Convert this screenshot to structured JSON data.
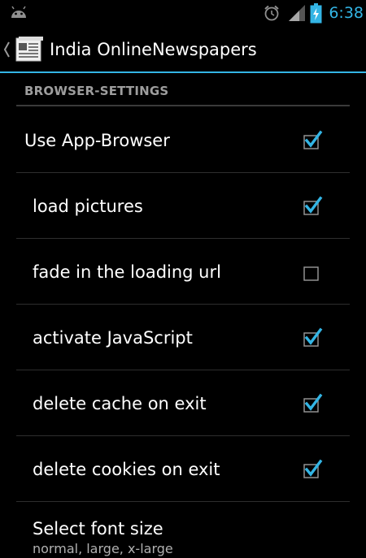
{
  "status_bar": {
    "time": "6:38",
    "icons": [
      "android-notification-icon",
      "alarm-icon",
      "signal-icon",
      "battery-charging-icon"
    ],
    "accent_color": "#33b5e5"
  },
  "action_bar": {
    "title": "India OnlineNewspapers",
    "up_icon": "chevron-left-icon",
    "app_icon": "newspaper-icon"
  },
  "settings": {
    "category": "BROWSER-SETTINGS",
    "items": [
      {
        "label": "Use App-Browser",
        "checked": true
      },
      {
        "label": "load pictures",
        "checked": true
      },
      {
        "label": "fade in the loading url",
        "checked": false
      },
      {
        "label": "activate JavaScript",
        "checked": true
      },
      {
        "label": "delete cache on exit",
        "checked": true
      },
      {
        "label": "delete cookies on exit",
        "checked": true
      }
    ],
    "font_size": {
      "title": "Select font size",
      "summary": "normal, large, x-large"
    }
  },
  "colors": {
    "check_accent": "#33b5e5",
    "header_text": "#9e9e9e",
    "background": "#000000"
  }
}
